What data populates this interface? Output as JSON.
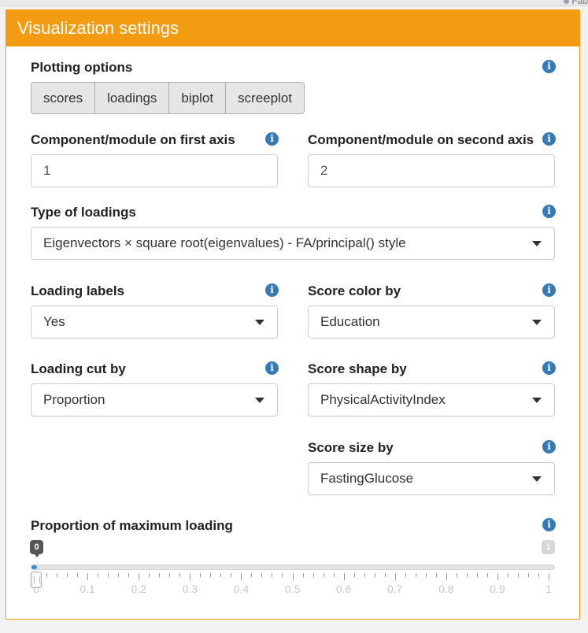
{
  "window": {
    "tab_fragment": "Fab"
  },
  "panel": {
    "title": "Visualization settings"
  },
  "plotting_options": {
    "label": "Plotting options",
    "buttons": [
      "scores",
      "loadings",
      "biplot",
      "screeplot"
    ]
  },
  "axis1": {
    "label": "Component/module on first axis",
    "value": "1"
  },
  "axis2": {
    "label": "Component/module on second axis",
    "value": "2"
  },
  "type_of_loadings": {
    "label": "Type of loadings",
    "selected": "Eigenvectors × square root(eigenvalues) - FA/principal() style"
  },
  "loading_labels": {
    "label": "Loading labels",
    "selected": "Yes"
  },
  "score_color_by": {
    "label": "Score color by",
    "selected": "Education"
  },
  "loading_cut_by": {
    "label": "Loading cut by",
    "selected": "Proportion"
  },
  "score_shape_by": {
    "label": "Score shape by",
    "selected": "PhysicalActivityIndex"
  },
  "score_size_by": {
    "label": "Score size by",
    "selected": "FastingGlucose"
  },
  "proportion_slider": {
    "label": "Proportion of maximum loading",
    "min_label": "0",
    "max_label": "1",
    "value": 0,
    "min": 0,
    "max": 1,
    "ticks": [
      "0",
      "0.1",
      "0.2",
      "0.3",
      "0.4",
      "0.5",
      "0.6",
      "0.7",
      "0.8",
      "0.9",
      "1"
    ]
  },
  "colors": {
    "header": "#f39c12",
    "info": "#337ab7",
    "slider_fill": "#428bca"
  },
  "icons": {
    "info": "info-icon",
    "caret": "chevron-down-icon",
    "handle": "slider-handle-icon"
  }
}
